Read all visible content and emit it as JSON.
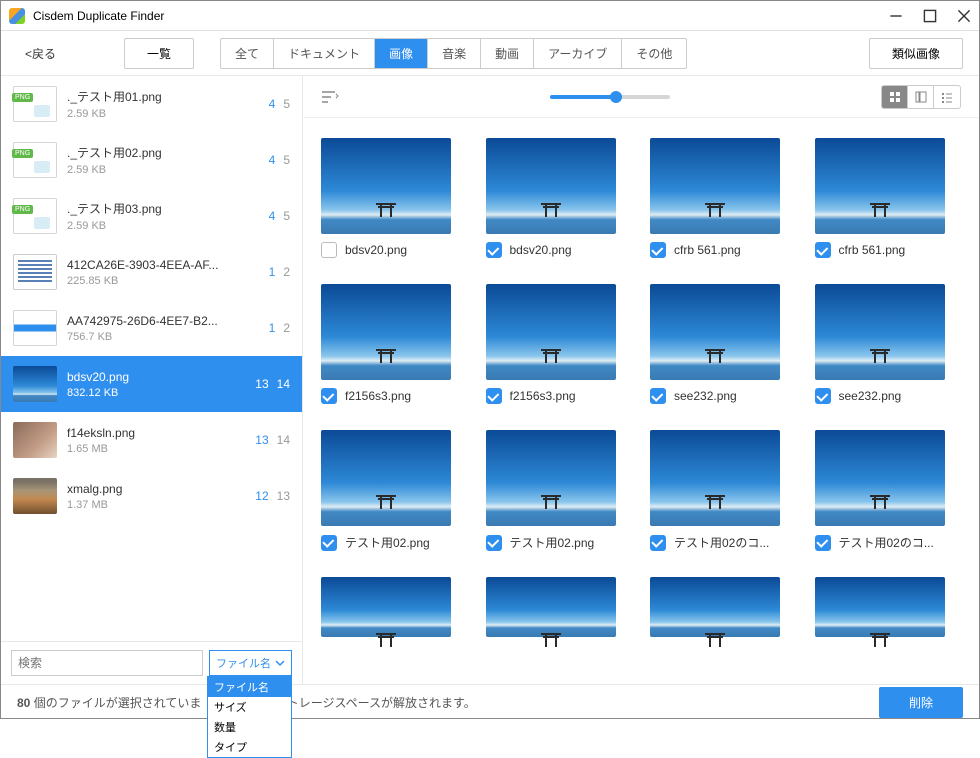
{
  "titlebar": {
    "title": "Cisdem Duplicate Finder"
  },
  "toolbar": {
    "back": "<戻る",
    "overview": "一覧",
    "similar": "類似画像",
    "tabs": [
      "全て",
      "ドキュメント",
      "画像",
      "音楽",
      "動画",
      "アーカイブ",
      "その他"
    ],
    "active_index": 2
  },
  "sidebar": {
    "items": [
      {
        "name": "._テスト用01.png",
        "size": "2.59 KB",
        "c1": "4",
        "c2": "5",
        "thumb": "pngicon"
      },
      {
        "name": "._テスト用02.png",
        "size": "2.59 KB",
        "c1": "4",
        "c2": "5",
        "thumb": "pngicon"
      },
      {
        "name": "._テスト用03.png",
        "size": "2.59 KB",
        "c1": "4",
        "c2": "5",
        "thumb": "pngicon"
      },
      {
        "name": "412CA26E-3903-4EEA-AF...",
        "size": "225.85 KB",
        "c1": "1",
        "c2": "2",
        "thumb": "doc"
      },
      {
        "name": "AA742975-26D6-4EE7-B2...",
        "size": "756.7 KB",
        "c1": "1",
        "c2": "2",
        "thumb": "bar"
      },
      {
        "name": "bdsv20.png",
        "size": "832.12 KB",
        "c1": "13",
        "c2": "14",
        "thumb": "sky",
        "selected": true
      },
      {
        "name": "f14eksln.png",
        "size": "1.65 MB",
        "c1": "13",
        "c2": "14",
        "thumb": "photo1"
      },
      {
        "name": "xmalg.png",
        "size": "1.37 MB",
        "c1": "12",
        "c2": "13",
        "thumb": "photo2"
      }
    ],
    "search_placeholder": "検索",
    "sort_label": "ファイル名",
    "sort_options": [
      "ファイル名",
      "サイズ",
      "数量",
      "タイプ"
    ]
  },
  "grid": {
    "cells": [
      {
        "name": "bdsv20.png",
        "checked": false
      },
      {
        "name": "bdsv20.png",
        "checked": true
      },
      {
        "name": "cfrb 561.png",
        "checked": true
      },
      {
        "name": "cfrb 561.png",
        "checked": true
      },
      {
        "name": "f2156s3.png",
        "checked": true
      },
      {
        "name": "f2156s3.png",
        "checked": true
      },
      {
        "name": "see232.png",
        "checked": true
      },
      {
        "name": "see232.png",
        "checked": true
      },
      {
        "name": "テスト用02.png",
        "checked": true
      },
      {
        "name": "テスト用02.png",
        "checked": true
      },
      {
        "name": "テスト用02のコ...",
        "checked": true
      },
      {
        "name": "テスト用02のコ...",
        "checked": true
      }
    ],
    "partial_row": 4
  },
  "footer": {
    "status_prefix": "80",
    "status_mid": " 個のファイルが選択されていま",
    "status_suffix": "ストレージスペースが解放されます。",
    "delete": "削除"
  }
}
